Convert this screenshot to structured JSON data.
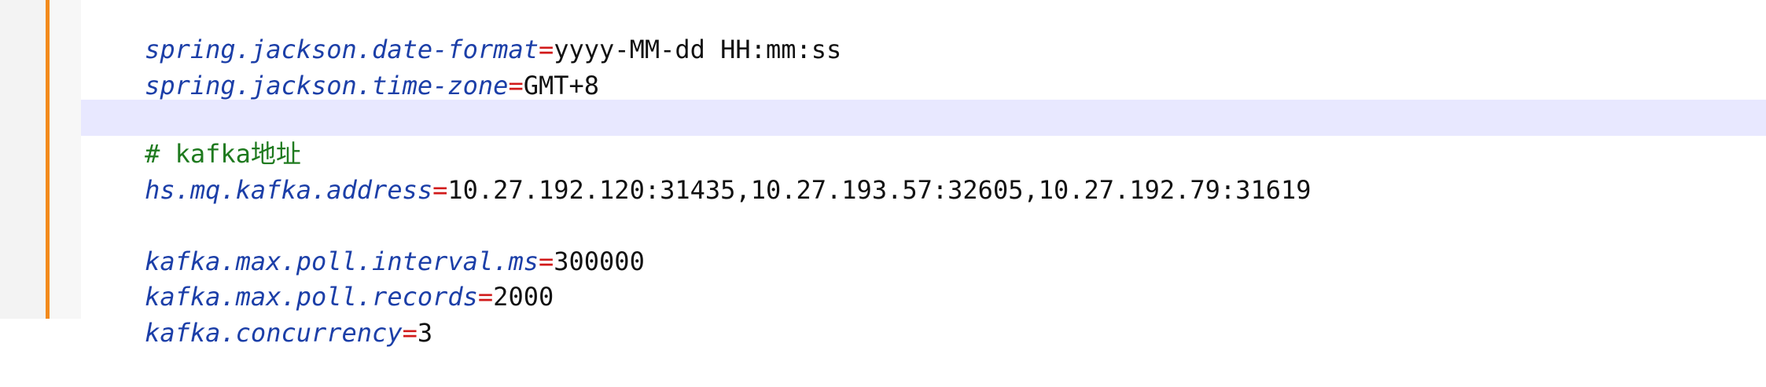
{
  "editor": {
    "lines": [
      {
        "type": "prop",
        "key": "spring.jackson.date-format",
        "eq": "=",
        "value": "yyyy-MM-dd HH:mm:ss"
      },
      {
        "type": "prop",
        "key": "spring.jackson.time-zone",
        "eq": "=",
        "value": "GMT+8"
      },
      {
        "type": "blank"
      },
      {
        "type": "comment",
        "text": "# kafka地址"
      },
      {
        "type": "prop",
        "key": "hs.mq.kafka.address",
        "eq": "=",
        "value": "10.27.192.120:31435,10.27.193.57:32605,10.27.192.79:31619"
      },
      {
        "type": "blank"
      },
      {
        "type": "prop",
        "key": "kafka.max.poll.interval.ms",
        "eq": "=",
        "value": "300000"
      },
      {
        "type": "prop",
        "key": "kafka.max.poll.records",
        "eq": "=",
        "value": "2000"
      },
      {
        "type": "prop",
        "key": "kafka.concurrency",
        "eq": "=",
        "value": "3"
      }
    ]
  }
}
